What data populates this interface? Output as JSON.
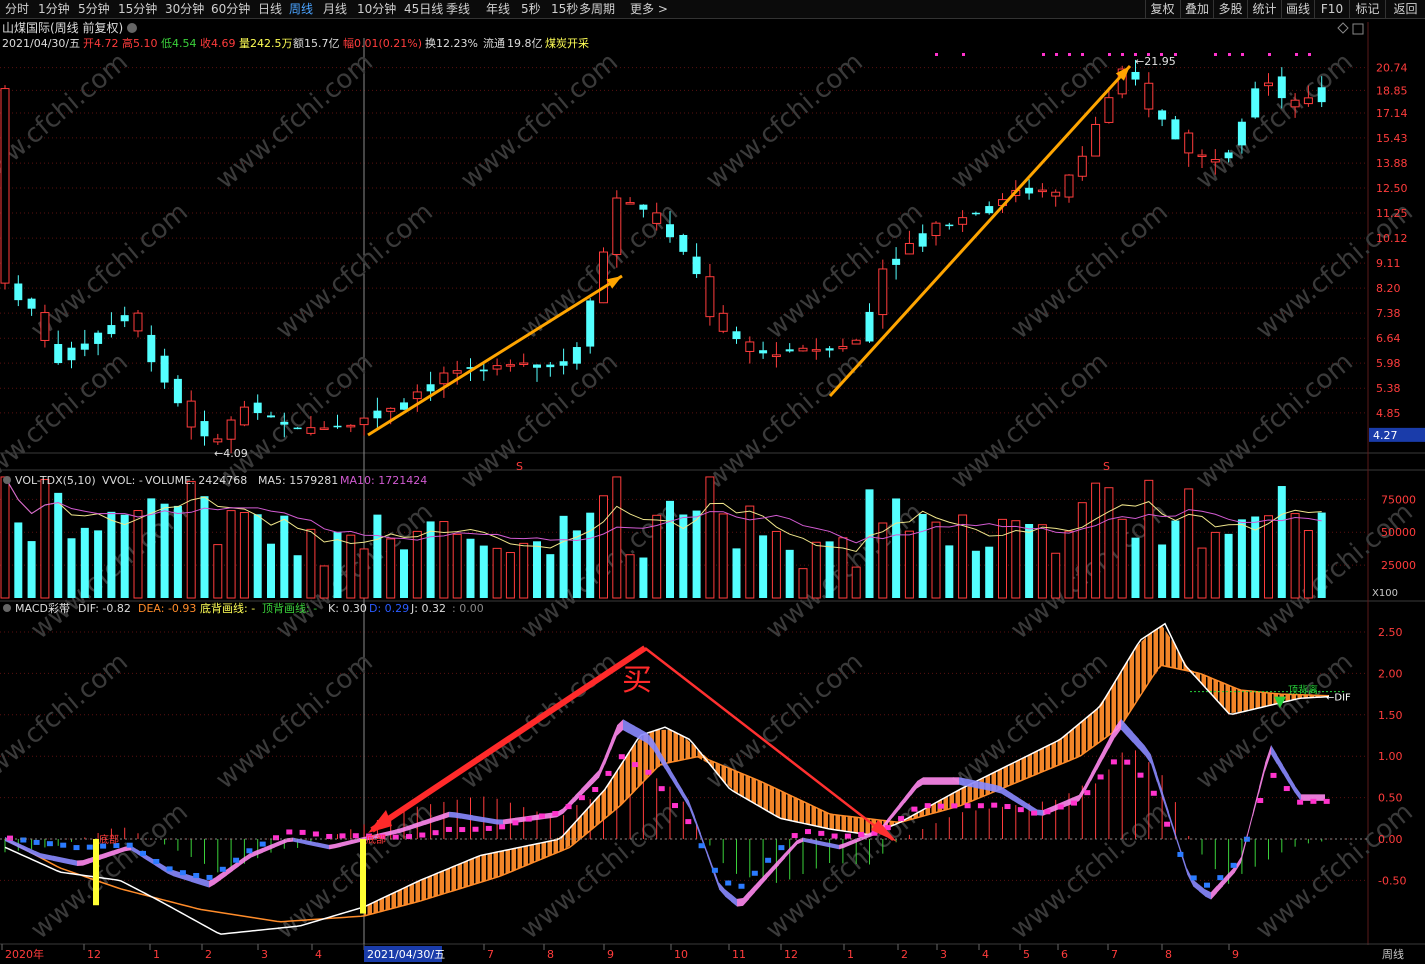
{
  "toolbar": {
    "periods": [
      "分时",
      "1分钟",
      "5分钟",
      "15分钟",
      "30分钟",
      "60分钟",
      "日线",
      "周线",
      "月线",
      "10分钟",
      "45日线",
      "季线",
      "年线",
      "5秒",
      "15秒",
      "多周期",
      "更多 >"
    ],
    "active_period": "周线",
    "right_buttons": [
      "复权",
      "叠加",
      "多股",
      "统计",
      "画线",
      "F10",
      "标记",
      "返回"
    ]
  },
  "header": {
    "title": "山煤国际(周线 前复权)",
    "date": "2021/04/30/五",
    "open_label": "开",
    "open": "4.72",
    "high_label": "高",
    "high": "5.10",
    "low_label": "低",
    "low": "4.54",
    "close_label": "收",
    "close": "4.69",
    "volume_label": "量",
    "volume": "242.5万",
    "amount_label": "额",
    "amount": "15.7亿",
    "change_label": "幅",
    "change": "0.01(0.21%)",
    "turnover_label": "换",
    "turnover": "12.23%",
    "float_label": "流通",
    "float_cap": "19.8亿",
    "industry": "煤炭开采"
  },
  "price_axis": {
    "labels": [
      "20.74",
      "18.85",
      "17.14",
      "15.43",
      "13.88",
      "12.50",
      "11.25",
      "10.12",
      "9.11",
      "8.20",
      "7.38",
      "6.64",
      "5.98",
      "5.38",
      "4.85"
    ],
    "current": "4.27"
  },
  "annotations": {
    "max_price": "21.95",
    "min_price": "4.09",
    "signal_mark": "S",
    "buy_text": "买"
  },
  "volume_panel": {
    "title": "VOL-TDX(5,10)",
    "vvol": "VVOL: -",
    "volume": "VOLUME: 2424768",
    "ma5": "MA5: 1579281",
    "ma10": "MA10: 1721424",
    "axis": [
      "75000",
      "50000",
      "25000"
    ],
    "unit": "X100"
  },
  "macd_panel": {
    "title": "MACD彩带",
    "dif": "DIF: -0.82",
    "dea": "DEA: -0.93",
    "bottom_line": "底背画线: -",
    "top_line": "顶背画线: -",
    "k": "K: 0.30",
    "d": "D: 0.29",
    "j": "J: 0.32",
    "extra": ": 0.00",
    "axis": [
      "2.50",
      "2.00",
      "1.50",
      "1.00",
      "0.50",
      "0.00",
      "-0.50"
    ],
    "label_top": "顶背离",
    "label_dif": "DIF",
    "label_bottom": "底部"
  },
  "time_axis": {
    "labels": [
      "2020年",
      "12",
      "1",
      "2",
      "3",
      "4",
      "2021/04/30/五",
      "7",
      "8",
      "9",
      "10",
      "11",
      "12",
      "1",
      "2",
      "3",
      "4",
      "5",
      "6",
      "7",
      "8",
      "9"
    ],
    "period": "周线"
  },
  "colors": {
    "up": "#ff3c3c",
    "down": "#54ffff",
    "arrow": "#ffa500",
    "buy": "#ff2a2a",
    "ma5": "#e8e8e8",
    "ma10": "#d25bd2",
    "dif": "#ffffff",
    "dea": "#ff8c2a",
    "band_purple": "#8a8aff",
    "band_pink": "#ff88ee",
    "macd_dot_pos": "#ff33cc",
    "macd_dot_neg": "#2b7bff",
    "grid": "#5a1010"
  },
  "chart_data": {
    "type": "candlestick",
    "title": "山煤国际(周线 前复权)",
    "price_points_read": [
      [
        "2020-11",
        7.0
      ],
      [
        "2021-04",
        4.09
      ],
      [
        "2021-09",
        12.5
      ],
      [
        "2021-12",
        5.9
      ],
      [
        "2022-01",
        6.6
      ],
      [
        "2022-06",
        21.95
      ],
      [
        "2022-08",
        13.88
      ],
      [
        "2022-09",
        20.74
      ]
    ],
    "current": 4.27,
    "volume_axis": [
      25000,
      50000,
      75000
    ],
    "macd": {
      "dif": -0.82,
      "dea": -0.93,
      "k": 0.3,
      "d": 0.29,
      "j": 0.32
    }
  }
}
